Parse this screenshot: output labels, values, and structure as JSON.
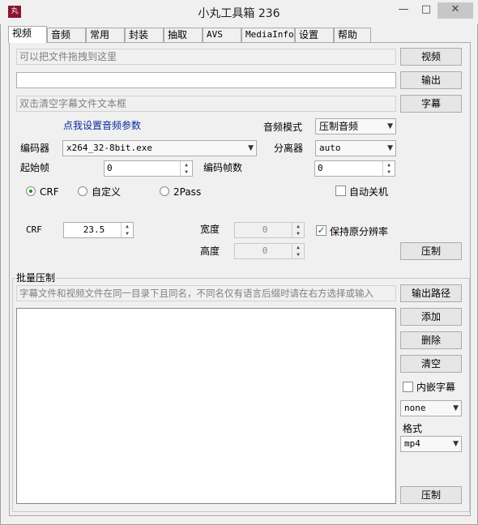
{
  "window": {
    "title": "小丸工具箱 236",
    "app_icon_text": "丸",
    "minimize": "—",
    "maximize": "□",
    "close": "✕"
  },
  "tabs": [
    "视频",
    "音频",
    "常用",
    "封装",
    "抽取",
    "AVS",
    "MediaInfo",
    "设置",
    "帮助"
  ],
  "video": {
    "video_input_placeholder": "可以把文件拖拽到这里",
    "video_button": "视频",
    "output_input_value": "",
    "output_button": "输出",
    "subtitle_input_placeholder": "双击清空字幕文件文本框",
    "subtitle_button": "字幕",
    "audio_settings_link": "点我设置音频参数",
    "audio_mode_label": "音频模式",
    "audio_mode_value": "压制音频",
    "encoder_label": "编码器",
    "encoder_value": "x264_32-8bit.exe",
    "demuxer_label": "分离器",
    "demuxer_value": "auto",
    "start_frame_label": "起始帧",
    "start_frame_value": "0",
    "encode_frames_label": "编码帧数",
    "encode_frames_value": "0",
    "mode_crf": "CRF",
    "mode_custom": "自定义",
    "mode_2pass": "2Pass",
    "auto_shutdown": "自动关机",
    "crf_label": "CRF",
    "crf_value": "23.5",
    "width_label": "宽度",
    "width_value": "0",
    "height_label": "高度",
    "height_value": "0",
    "keep_resolution": "保持原分辨率",
    "encode_button": "压制"
  },
  "batch": {
    "group_label": "批量压制",
    "hint": "字幕文件和视频文件在同一目录下且同名，不同名仅有语言后缀时请在右方选择或输入",
    "output_path_button": "输出路径",
    "add_button": "添加",
    "delete_button": "删除",
    "clear_button": "清空",
    "embed_subtitle": "内嵌字幕",
    "subtitle_lang_value": "none",
    "format_label": "格式",
    "format_value": "mp4",
    "encode_button": "压制"
  },
  "glyphs": {
    "dropdown": "▼",
    "up": "▲",
    "down": "▼",
    "check": "✓"
  }
}
